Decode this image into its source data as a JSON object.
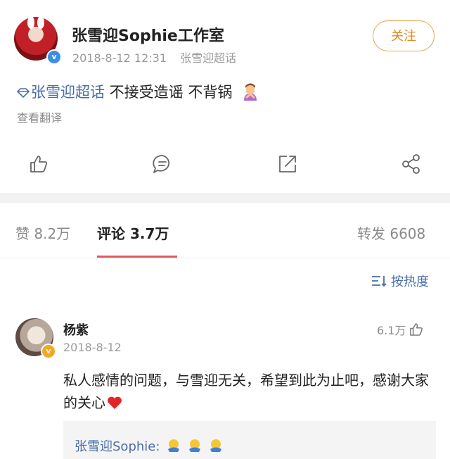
{
  "header": {
    "author": "张雪迎Sophie工作室",
    "timestamp": "2018-8-12 12:31",
    "source": "张雪迎超话",
    "follow_label": "关注",
    "verified": true
  },
  "post": {
    "topic": "张雪迎超话",
    "text": " 不接受造谣 不背锅",
    "emoji": "woman-gesturing-no",
    "translate_label": "查看翻译"
  },
  "actions": [
    "like-icon",
    "comment-icon",
    "share-icon",
    "more-share-icon"
  ],
  "tabs": {
    "likes": "赞 8.2万",
    "comments": "评论 3.7万",
    "reposts": "转发 6608"
  },
  "sort": {
    "label": "按热度"
  },
  "comment": {
    "user": "杨紫",
    "date": "2018-8-12",
    "likes": "6.1万",
    "text": "私人感情的问题，与雪迎无关，希望到此为止吧，感谢大家的关心",
    "reply_user": "张雪迎Sophie:",
    "reply_emoji_count": 3
  },
  "colors": {
    "link": "#4a6ea8",
    "follow": "#e38a1a",
    "tab_underline": "#e05a5a"
  }
}
